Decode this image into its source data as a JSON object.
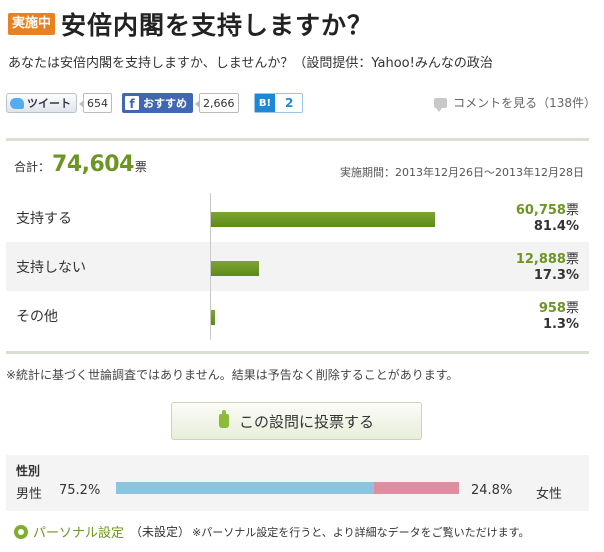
{
  "header": {
    "badge": "実施中",
    "title": "安倍内閣を支持しますか？",
    "subtitle": "あなたは安倍内閣を支持しますか、しませんか？（設問提供：Yahoo!みんなの政治"
  },
  "social": {
    "tweet_label": "ツイート",
    "tweet_count": "654",
    "fb_label": "おすすめ",
    "fb_count": "2,666",
    "hatena_logo": "B!",
    "hatena_count": "2",
    "comments_label": "コメントを見る（138件）"
  },
  "summary": {
    "total_label": "合計：",
    "total_votes": "74,604",
    "total_unit": "票",
    "period": "実施期間：2013年12月26日〜2013年12月28日"
  },
  "results": [
    {
      "label": "支持する",
      "votes": "60,758",
      "unit": "票",
      "percent": "81.4%",
      "share": 81.4
    },
    {
      "label": "支持しない",
      "votes": "12,888",
      "unit": "票",
      "percent": "17.3%",
      "share": 17.3
    },
    {
      "label": "その他",
      "votes": "958",
      "unit": "票",
      "percent": "1.3%",
      "share": 1.3
    }
  ],
  "note": "※統計に基づく世論調査ではありません。結果は予告なく削除することがあります。",
  "vote_button": "この設問に投票する",
  "gender": {
    "title": "性別",
    "male_label": "男性",
    "male_pct": "75.2%",
    "male_share": 75.2,
    "female_pct": "24.8%",
    "female_share": 24.8,
    "female_label": "女性",
    "male_color": "#8bc4df",
    "female_color": "#df8ea2"
  },
  "personal": {
    "link": "パーソナル設定",
    "status": "（未設定）",
    "desc": "※パーソナル設定を行うと、より詳細なデータをご覧いただけます。"
  },
  "colors": {
    "accent": "#6d9524",
    "badge": "#e8811f"
  }
}
